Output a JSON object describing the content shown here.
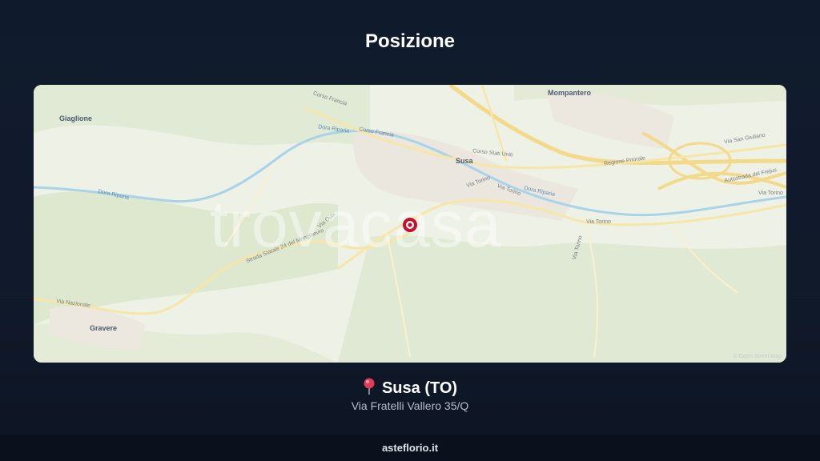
{
  "header": {
    "title": "Posizione"
  },
  "map": {
    "place_labels": {
      "giaglione": "Giaglione",
      "mompantero": "Mompantero",
      "susa": "Susa",
      "gravere": "Gravere"
    },
    "road_labels": {
      "corso_francia_1": "Corso Francia",
      "corso_francia_2": "Corso Francia",
      "corso_stati_uniti": "Corso Stati Uniti",
      "regione_priorale": "Regione Priorale",
      "via_san_giuliano": "Via San Giuliano",
      "autostrada_frejus": "Autostrada del Frejus",
      "via_torino_1": "Via Torino",
      "via_torino_2": "Via Torino",
      "via_torino_3": "Via Torino",
      "via_torino_4": "Via Torino",
      "via_torino_5": "Via Torino",
      "via_oulx": "Via Oulx",
      "strada_moncenisio": "Strada Statale 24 del Monginevro",
      "via_nazionale": "Via Nazionale",
      "dora_riparia_1": "Dora Riparia",
      "dora_riparia_2": "Dora Riparia",
      "dora_riparia_3": "Dora Riparia"
    },
    "watermark": "trovacasa",
    "attribution": "© Open Street Map",
    "marker_icon": "location-marker-icon",
    "colors": {
      "marker": "#c8102e",
      "water": "#a9d3e8",
      "road": "#f6e6a8",
      "forest": "#dfe8d2"
    }
  },
  "location": {
    "pin_icon": "round-pushpin-icon",
    "city": "Susa (TO)",
    "address": "Via Fratelli Vallero 35/Q"
  },
  "footer": {
    "site": "asteflorio.it"
  }
}
